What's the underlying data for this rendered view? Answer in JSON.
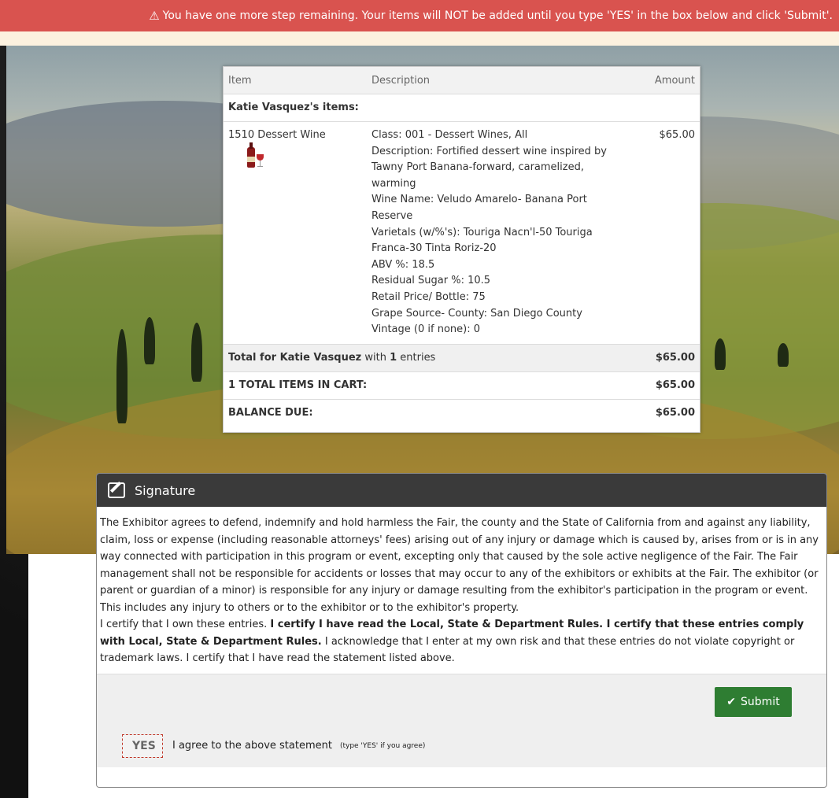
{
  "alert": {
    "message": "You have one more step remaining. Your items will NOT be added until you type 'YES' in the box below and click 'Submit'."
  },
  "cart": {
    "headers": {
      "item": "Item",
      "description": "Description",
      "amount": "Amount"
    },
    "owner_label": "Katie Vasquez's items:",
    "entry": {
      "item": "1510 Dessert Wine",
      "amount": "$65.00",
      "description_lines": [
        "Class: 001 - Dessert Wines, All",
        "Description: Fortified dessert wine inspired by",
        "Tawny Port Banana-forward, caramelized,",
        "warming",
        "Wine Name: Veludo Amarelo- Banana Port",
        "Reserve",
        "Varietals (w/%'s): Touriga Nacn'l-50 Touriga",
        "Franca-30 Tinta Roriz-20",
        "ABV %: 18.5",
        "Residual Sugar %: 10.5",
        "Retail Price/ Bottle: 75",
        "Grape Source- County: San Diego County",
        "Vintage (0 if none): 0"
      ]
    },
    "total_row": {
      "label_bold": "Total for Katie Vasquez",
      "label_mid": " with ",
      "count": "1",
      "label_end": " entries",
      "amount": "$65.00"
    },
    "items_total": {
      "label": "1 TOTAL ITEMS IN CART:",
      "amount": "$65.00"
    },
    "balance": {
      "label": "BALANCE DUE:",
      "amount": "$65.00"
    }
  },
  "signature": {
    "title": "Signature",
    "para1": "The Exhibitor agrees to defend, indemnify and hold harmless the Fair, the county and the State of California from and against any liability, claim, loss or expense (including reasonable attorneys' fees) arising out of any injury or damage which is caused by, arises from or is in any way connected with participation in this program or event, excepting only that caused by the sole active negligence of the Fair. The Fair management shall not be responsible for accidents or losses that may occur to any of the exhibitors or exhibits at the Fair.  The exhibitor (or parent or guardian of a minor) is responsible for any injury or damage resulting from the exhibitor's participation in the program or event.  This includes any injury to others or to the exhibitor or to the exhibitor's property.",
    "para2_start": "I certify that I own these entries. ",
    "para2_bold": "I certify I have read the Local, State & Department Rules.  I certify that these entries comply with Local, State & Department Rules.",
    "para2_end": "  I acknowledge that I enter at my own risk and that these entries do not violate copyright or trademark laws.  I certify that I have read the statement listed above.",
    "submit_label": "Submit",
    "yes_value": "YES",
    "agree_text": "I agree to the above statement",
    "agree_note": "(type 'YES' if you agree)"
  }
}
